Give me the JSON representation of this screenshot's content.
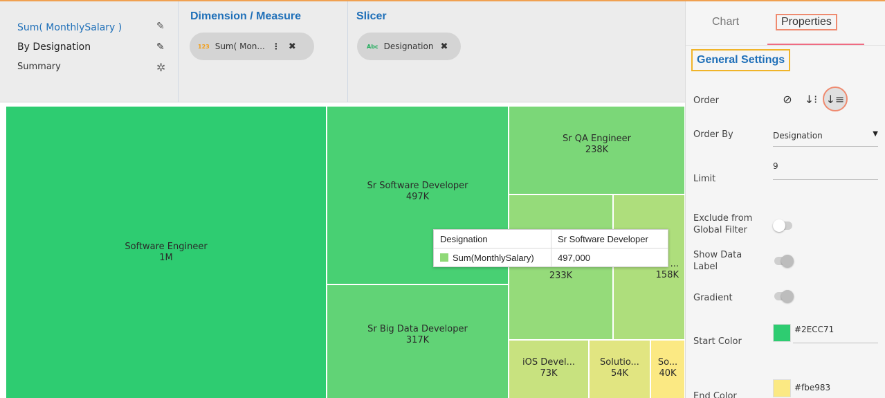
{
  "fields": {
    "items": [
      {
        "label": "Sum( MonthlySalary )"
      },
      {
        "label": "By Designation"
      },
      {
        "label": "Summary"
      }
    ]
  },
  "dimension_measure": {
    "title": "Dimension / Measure",
    "pill": {
      "type_tag": "123",
      "text": "Sum( Mon...",
      "more": "⋮",
      "close": "✖"
    }
  },
  "slicer": {
    "title": "Slicer",
    "pill": {
      "type_tag": "Abc",
      "text": "Designation",
      "close": "✖"
    }
  },
  "chart_data": {
    "type": "treemap",
    "measure": "Sum(MonthlySalary)",
    "dimension": "Designation",
    "start_color": "#2ECC71",
    "end_color": "#fbe983",
    "tiles": [
      {
        "label": "Software Engineer",
        "value_label": "1M"
      },
      {
        "label": "Sr Software Developer",
        "value_label": "497K"
      },
      {
        "label": "Sr Big Data Developer",
        "value_label": "317K"
      },
      {
        "label": "Sr QA Engineer",
        "value_label": "238K"
      },
      {
        "label": "",
        "value_label": "233K"
      },
      {
        "label": "...",
        "value_label": "158K"
      },
      {
        "label": "iOS Devel...",
        "value_label": "73K"
      },
      {
        "label": "Solutio...",
        "value_label": "54K"
      },
      {
        "label": "So...",
        "value_label": "40K"
      }
    ],
    "tooltip": {
      "header_key": "Designation",
      "header_value": "Sr Software Developer",
      "row_key": "Sum(MonthlySalary)",
      "row_value": "497,000",
      "swatch_color": "#8fd977"
    }
  },
  "right_panel": {
    "tabs": [
      {
        "label": "Chart"
      },
      {
        "label": "Properties"
      }
    ],
    "section_title": "General Settings",
    "order": {
      "label": "Order",
      "icons": [
        {
          "glyph": "⊘"
        },
        {
          "glyph": "↓⁝"
        },
        {
          "glyph": "↓≡"
        }
      ]
    },
    "order_by": {
      "label": "Order By",
      "value": "Designation",
      "caret": "▼"
    },
    "limit": {
      "label": "Limit",
      "value": "9"
    },
    "exclude": {
      "label_line1": "Exclude from",
      "label_line2": "Global Filter",
      "on": false
    },
    "show_data_label": {
      "label_line1": "Show Data",
      "label_line2": "Label",
      "on": true
    },
    "gradient": {
      "label": "Gradient",
      "on": true
    },
    "start_color": {
      "label": "Start Color",
      "value": "#2ECC71"
    },
    "end_color": {
      "label": "End Color",
      "value": "#fbe983"
    }
  }
}
